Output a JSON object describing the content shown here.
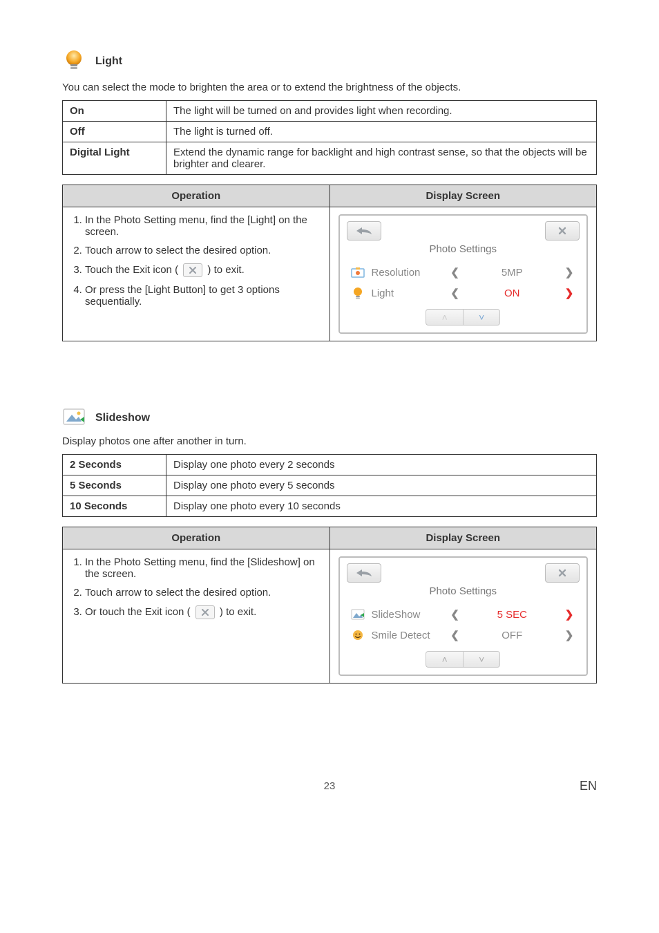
{
  "light": {
    "title": "Light",
    "intro": "You can select the mode to brighten the area or to extend the brightness of the objects.",
    "table": {
      "on": {
        "k": "On",
        "v": "The light will be turned on and provides light when recording."
      },
      "off": {
        "k": "Off",
        "v": "The light is turned off."
      },
      "digital": {
        "k": "Digital Light",
        "v": "Extend the dynamic range for backlight and high contrast sense, so that the objects will be brighter and clearer."
      }
    },
    "op_header": "Operation",
    "ds_header": "Display Screen",
    "steps": {
      "s1": "In the Photo Setting menu, find the [Light] on the screen.",
      "s2": "Touch arrow to select the desired option.",
      "s3a": "Touch the Exit icon (",
      "s3b": ") to exit.",
      "s4": "Or press the [Light Button] to get 3 options sequentially."
    },
    "panel": {
      "title": "Photo Settings",
      "row1_label": "Resolution",
      "row1_value": "5MP",
      "row2_label": "Light",
      "row2_value": "ON"
    }
  },
  "slideshow": {
    "title": "Slideshow",
    "intro": "Display photos one after another in turn.",
    "table": {
      "r1": {
        "k": "2 Seconds",
        "v": "Display one photo every 2 seconds"
      },
      "r2": {
        "k": "5 Seconds",
        "v": "Display one photo every 5 seconds"
      },
      "r3": {
        "k": "10 Seconds",
        "v": "Display one photo every 10 seconds"
      }
    },
    "op_header": "Operation",
    "ds_header": "Display Screen",
    "steps": {
      "s1": "In the Photo Setting menu, find the [Slideshow] on the screen.",
      "s2": "Touch arrow to select the desired option.",
      "s3a": "Or touch the Exit icon (",
      "s3b": ") to exit."
    },
    "panel": {
      "title": "Photo Settings",
      "row1_label": "SlideShow",
      "row1_value": "5 SEC",
      "row2_label": "Smile Detect",
      "row2_value": "OFF"
    }
  },
  "footer": {
    "page": "23",
    "lang": "EN"
  },
  "glyphs": {
    "left": "❮",
    "right": "❯",
    "up": "˄",
    "down": "˅"
  }
}
